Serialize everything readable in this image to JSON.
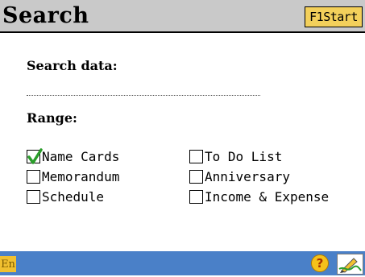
{
  "header": {
    "title": "Search",
    "start_button": "F1Start"
  },
  "search": {
    "label": "Search data:",
    "value": ""
  },
  "range": {
    "label": "Range:",
    "options": [
      {
        "label": "Name Cards",
        "checked": true
      },
      {
        "label": "To Do List",
        "checked": false
      },
      {
        "label": "Memorandum",
        "checked": false
      },
      {
        "label": "Anniversary",
        "checked": false
      },
      {
        "label": "Schedule",
        "checked": false
      },
      {
        "label": "Income & Expense",
        "checked": false
      }
    ]
  },
  "footer": {
    "language_indicator": "En",
    "help_icon": "question-mark-icon",
    "handwriting_icon": "pen-icon"
  },
  "colors": {
    "header_bg": "#c9c9c9",
    "footer_bg": "#4a80c8",
    "button_bg": "#f3d05b",
    "check_color": "#2a9d2a"
  }
}
